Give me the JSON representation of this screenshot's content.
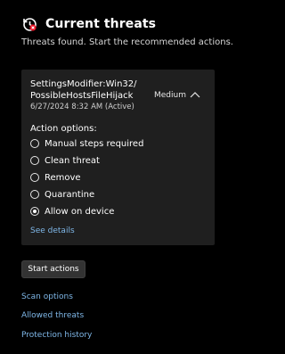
{
  "header": {
    "title": "Current threats",
    "subtitle": "Threats found. Start the recommended actions.",
    "icon": "threat-history-icon"
  },
  "threat": {
    "name_line1": "SettingsModifier:Win32/",
    "name_line2": "PossibleHostsFileHijack",
    "date": "6/27/2024 8:32 AM (Active)",
    "severity": "Medium",
    "expanded": true,
    "options_label": "Action options:",
    "options": [
      {
        "label": "Manual steps required",
        "selected": false
      },
      {
        "label": "Clean threat",
        "selected": false
      },
      {
        "label": "Remove",
        "selected": false
      },
      {
        "label": "Quarantine",
        "selected": false
      },
      {
        "label": "Allow on device",
        "selected": true
      }
    ],
    "see_details": "See details"
  },
  "actions": {
    "start_label": "Start actions"
  },
  "links": {
    "scan_options": "Scan options",
    "allowed_threats": "Allowed threats",
    "protection_history": "Protection history"
  },
  "colors": {
    "background": "#000000",
    "card": "#1f1f1f",
    "link": "#7fb7e8",
    "button": "#333333"
  }
}
